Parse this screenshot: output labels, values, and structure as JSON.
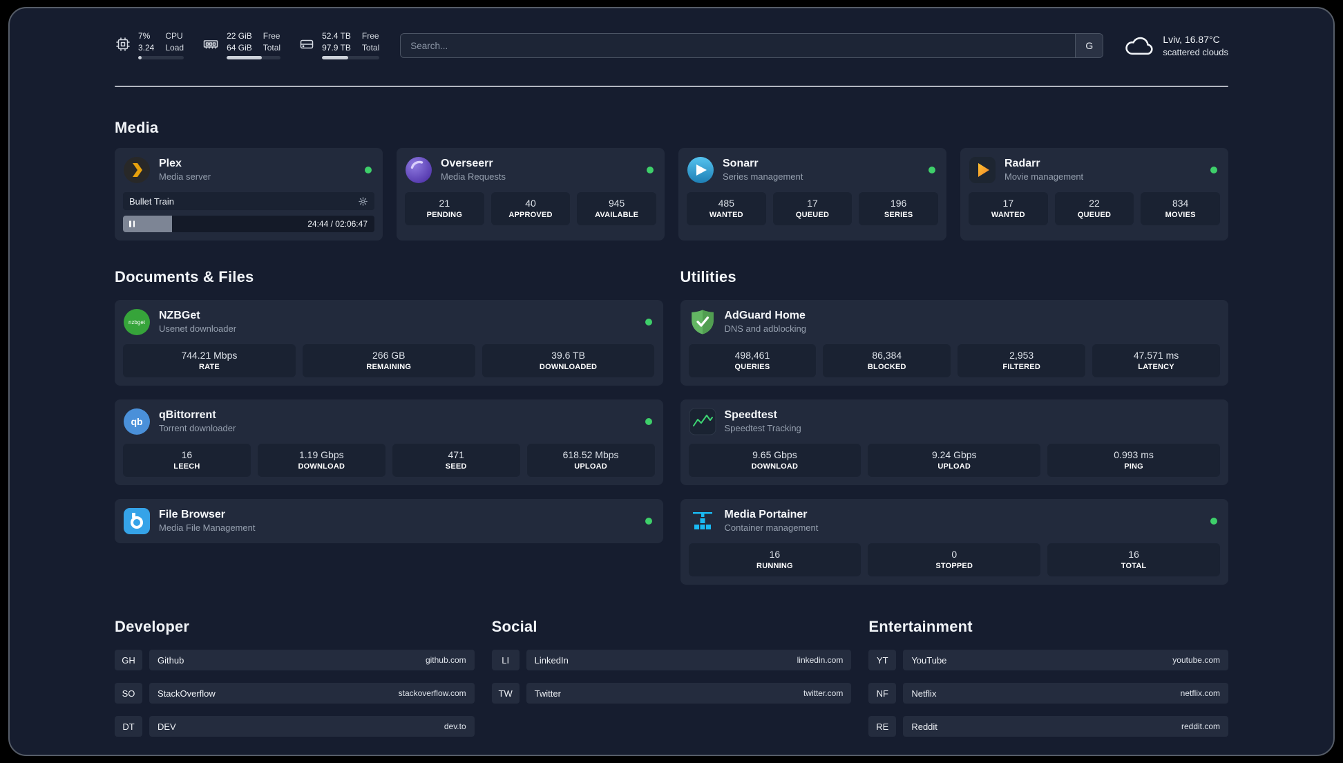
{
  "topbar": {
    "cpu": {
      "usage": "7%",
      "load": "3.24",
      "label_line1": "CPU",
      "label_line2": "Load",
      "bar_percent": 7
    },
    "memory": {
      "free": "22 GiB",
      "total": "64 GiB",
      "free_label": "Free",
      "total_label": "Total",
      "bar_percent": 65
    },
    "storage": {
      "free": "52.4 TB",
      "total": "97.9 TB",
      "free_label": "Free",
      "total_label": "Total",
      "bar_percent": 46
    },
    "search": {
      "placeholder": "Search...",
      "engine_button": "G"
    },
    "weather": {
      "location": "Lviv, 16.87°C",
      "condition": "scattered clouds"
    }
  },
  "sections": {
    "media": "Media",
    "documents": "Documents & Files",
    "utilities": "Utilities",
    "developer": "Developer",
    "social": "Social",
    "entertainment": "Entertainment"
  },
  "apps": {
    "plex": {
      "name": "Plex",
      "subtitle": "Media server",
      "now_playing": "Bullet Train",
      "elapsed": "24:44 / 02:06:47",
      "progress_percent": 19.5
    },
    "overseerr": {
      "name": "Overseerr",
      "subtitle": "Media Requests",
      "stats": [
        {
          "value": "21",
          "label": "PENDING"
        },
        {
          "value": "40",
          "label": "APPROVED"
        },
        {
          "value": "945",
          "label": "AVAILABLE"
        }
      ]
    },
    "sonarr": {
      "name": "Sonarr",
      "subtitle": "Series management",
      "stats": [
        {
          "value": "485",
          "label": "WANTED"
        },
        {
          "value": "17",
          "label": "QUEUED"
        },
        {
          "value": "196",
          "label": "SERIES"
        }
      ]
    },
    "radarr": {
      "name": "Radarr",
      "subtitle": "Movie management",
      "stats": [
        {
          "value": "17",
          "label": "WANTED"
        },
        {
          "value": "22",
          "label": "QUEUED"
        },
        {
          "value": "834",
          "label": "MOVIES"
        }
      ]
    },
    "nzbget": {
      "name": "NZBGet",
      "subtitle": "Usenet downloader",
      "icon_text": "nzbget",
      "stats": [
        {
          "value": "744.21 Mbps",
          "label": "RATE"
        },
        {
          "value": "266 GB",
          "label": "REMAINING"
        },
        {
          "value": "39.6 TB",
          "label": "DOWNLOADED"
        }
      ]
    },
    "qbittorrent": {
      "name": "qBittorrent",
      "subtitle": "Torrent downloader",
      "icon_text": "qb",
      "stats": [
        {
          "value": "16",
          "label": "LEECH"
        },
        {
          "value": "1.19 Gbps",
          "label": "DOWNLOAD"
        },
        {
          "value": "471",
          "label": "SEED"
        },
        {
          "value": "618.52 Mbps",
          "label": "UPLOAD"
        }
      ]
    },
    "filebrowser": {
      "name": "File Browser",
      "subtitle": "Media File Management"
    },
    "adguard": {
      "name": "AdGuard Home",
      "subtitle": "DNS and adblocking",
      "stats": [
        {
          "value": "498,461",
          "label": "QUERIES"
        },
        {
          "value": "86,384",
          "label": "BLOCKED"
        },
        {
          "value": "2,953",
          "label": "FILTERED"
        },
        {
          "value": "47.571 ms",
          "label": "LATENCY"
        }
      ]
    },
    "speedtest": {
      "name": "Speedtest",
      "subtitle": "Speedtest Tracking",
      "stats": [
        {
          "value": "9.65 Gbps",
          "label": "DOWNLOAD"
        },
        {
          "value": "9.24 Gbps",
          "label": "UPLOAD"
        },
        {
          "value": "0.993 ms",
          "label": "PING"
        }
      ]
    },
    "portainer": {
      "name": "Media Portainer",
      "subtitle": "Container management",
      "stats": [
        {
          "value": "16",
          "label": "RUNNING"
        },
        {
          "value": "0",
          "label": "STOPPED"
        },
        {
          "value": "16",
          "label": "TOTAL"
        }
      ]
    }
  },
  "bookmarks": {
    "developer": [
      {
        "abbr": "GH",
        "name": "Github",
        "url": "github.com"
      },
      {
        "abbr": "SO",
        "name": "StackOverflow",
        "url": "stackoverflow.com"
      },
      {
        "abbr": "DT",
        "name": "DEV",
        "url": "dev.to"
      }
    ],
    "social": [
      {
        "abbr": "LI",
        "name": "LinkedIn",
        "url": "linkedin.com"
      },
      {
        "abbr": "TW",
        "name": "Twitter",
        "url": "twitter.com"
      }
    ],
    "entertainment": [
      {
        "abbr": "YT",
        "name": "YouTube",
        "url": "youtube.com"
      },
      {
        "abbr": "NF",
        "name": "Netflix",
        "url": "netflix.com"
      },
      {
        "abbr": "RE",
        "name": "Reddit",
        "url": "reddit.com"
      }
    ]
  }
}
